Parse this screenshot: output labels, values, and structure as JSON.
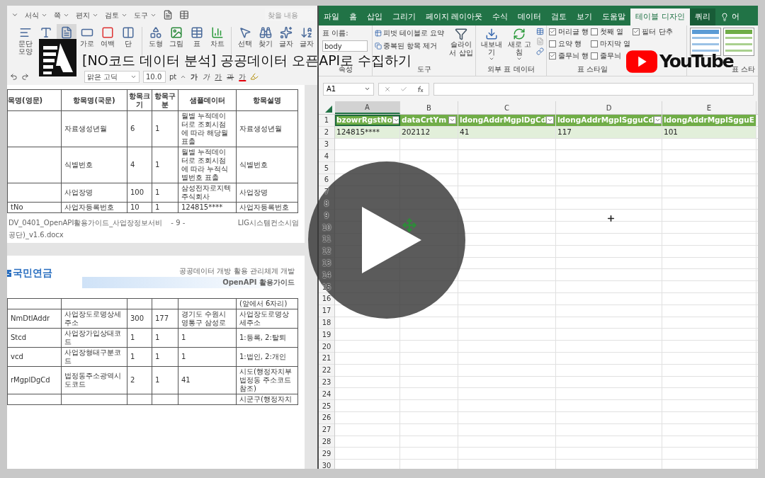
{
  "video": {
    "title": "[NO코드 데이터 분석] 공공데이터 오픈API로 수집하기",
    "platform": "YouTube"
  },
  "word": {
    "menu": [
      "서식",
      "쪽",
      "편지",
      "검토",
      "도구"
    ],
    "search": {
      "placeholder": "찾을 내용"
    },
    "ribbon": [
      {
        "label": "문단 모양",
        "selected": false
      },
      {
        "selected": false
      },
      {
        "selected": true
      },
      {
        "label": "가로",
        "selected": false
      },
      {
        "label": "여백",
        "selected": false
      },
      {
        "label": "단",
        "selected": false
      },
      {
        "label": "도형",
        "selected": false
      },
      {
        "label": "그림",
        "selected": false
      },
      {
        "label": "표",
        "selected": false
      },
      {
        "label": "차트",
        "selected": false
      },
      {
        "label": "선택",
        "selected": false
      },
      {
        "label": "찾기",
        "selected": false
      },
      {
        "label": "글자",
        "selected": false
      },
      {
        "label": "글자",
        "selected": false
      }
    ],
    "font_bar": {
      "font": "맑은 고딕",
      "size": "10.0",
      "unit": "pt",
      "format_buttons": [
        "가",
        "가",
        "가",
        "과",
        "가"
      ]
    },
    "page1": {
      "columns": [
        "목명(영문)",
        "항목명(국문)",
        "항목크기",
        "항목구분",
        "샘플데이터",
        "항목설명"
      ],
      "rows": [
        [
          null,
          "자료생성년월",
          "6",
          "1",
          "월별 누적데이터로 조회시점에 따라 해당월 표출",
          "자료생성년월"
        ],
        [
          null,
          "식별번호",
          "4",
          "1",
          "월별 누적데이터로 조회시점에 따라 누적식별번호 표출",
          "식별번호"
        ],
        [
          null,
          "사업장명",
          "100",
          "1",
          "삼성전자로지텍주식회사",
          "사업장명"
        ],
        [
          "tNo",
          "사업자등록번호",
          "10",
          "1",
          "124815****",
          "사업자등록번호"
        ]
      ],
      "footer_left": "DV_0401_OpenAPI활용가이드_사업장정보서비",
      "page_number": "- 9 -",
      "footer_right": "LIG시스템컨소시엄",
      "footer_left_2": "공단)_v1.6.docx"
    },
    "page2": {
      "logo_text": "국민연금",
      "header_1": "공공데이터 개방 활용 관리체계 개발",
      "header_2": "OpenAPI 활용가이드",
      "rows": [
        [
          null,
          null,
          null,
          null,
          null,
          "(앞에서 6자리)"
        ],
        [
          "NmDtlAddr",
          "사업장도로명상세주소",
          "300",
          "177",
          "경기도 수원시 영통구 삼성로",
          "사업장도로명상세주소"
        ],
        [
          "Stcd",
          "사업장가입상태코드",
          "1",
          "1",
          "1",
          "1:등록, 2:탈퇴"
        ],
        [
          "vcd",
          "사업장형태구분코드",
          "1",
          "1",
          "1",
          "1:법인, 2:개인"
        ],
        [
          "rMgplDgCd",
          "법정동주소광역시도코드",
          "2",
          "1",
          "41",
          "시도(행정자치부 법정동 주소코드 참조)"
        ],
        [
          null,
          null,
          null,
          null,
          null,
          "시군구(행정자치"
        ]
      ]
    }
  },
  "excel": {
    "tabs": [
      {
        "label": "파일",
        "selected": false,
        "kind": "tab"
      },
      {
        "label": "홈",
        "selected": false,
        "kind": "tab"
      },
      {
        "label": "삽입",
        "selected": false,
        "kind": "tab"
      },
      {
        "label": "그리기",
        "selected": false,
        "kind": "tab"
      },
      {
        "label": "페이지 레이아웃",
        "selected": false,
        "kind": "tab"
      },
      {
        "label": "수식",
        "selected": false,
        "kind": "tab"
      },
      {
        "label": "데이터",
        "selected": false,
        "kind": "tab"
      },
      {
        "label": "검토",
        "selected": false,
        "kind": "tab"
      },
      {
        "label": "보기",
        "selected": false,
        "kind": "tab"
      },
      {
        "label": "도움말",
        "selected": false,
        "kind": "tab"
      },
      {
        "label": "테이블 디자인",
        "selected": true,
        "kind": "tab"
      },
      {
        "label": "쿼리",
        "selected": false,
        "kind": "context"
      },
      {
        "label": "어",
        "selected": false,
        "kind": "search"
      }
    ],
    "table_name_label": "표 이름:",
    "table_name": "body",
    "group_properties": "속성",
    "tools": [
      "피벗 테이블로 요약",
      "중복된 항목 제거"
    ],
    "slicer": "슬라이서 삽입",
    "group_tools": "도구",
    "external": [
      "내보내기",
      "새로 고침"
    ],
    "group_external": "외부 표 데이터",
    "style_options": [
      {
        "label": "머리글 행",
        "checked": true
      },
      {
        "label": "요약 행",
        "checked": false
      },
      {
        "label": "줄무늬 행",
        "checked": true
      },
      {
        "label": "첫째 열",
        "checked": false
      },
      {
        "label": "마지막 열",
        "checked": false
      },
      {
        "label": "줄무늬",
        "checked": false
      },
      {
        "label": "필터 단추",
        "checked": true
      }
    ],
    "group_style_options": "표 스타일",
    "group_styles": "표 스타",
    "name_box": "A1",
    "columns": [
      {
        "label": "A",
        "selected": true
      },
      {
        "label": "B",
        "selected": false
      },
      {
        "label": "C",
        "selected": false
      },
      {
        "label": "D",
        "selected": false
      },
      {
        "label": "E",
        "selected": false
      }
    ],
    "rows": [
      {
        "kind": "header",
        "cells": [
          {
            "text": "bzowrRgstNo",
            "selected": true,
            "filter_button": true
          },
          {
            "text": "dataCrtYm",
            "selected": false,
            "filter_button": true
          },
          {
            "text": "ldongAddrMgplDgCd",
            "selected": false,
            "filter_button": true
          },
          {
            "text": "ldongAddrMgplSgguCd",
            "selected": false,
            "filter_button": true
          },
          {
            "text": "ldongAddrMgplSgguE",
            "selected": false,
            "filter_button": false
          }
        ]
      },
      {
        "kind": "data",
        "cells": [
          {
            "text": "124815****",
            "selected": false
          },
          {
            "text": "202112",
            "selected": false
          },
          {
            "text": "41",
            "selected": false
          },
          {
            "text": "117",
            "selected": false
          },
          {
            "text": "101",
            "selected": false
          }
        ]
      }
    ],
    "row_numbers": [
      "1",
      "2",
      "3",
      "4",
      "5",
      "6",
      "7",
      "8",
      "9",
      "10",
      "11",
      "12",
      "13",
      "14",
      "15",
      "16",
      "17",
      "18",
      "19",
      "20",
      "21",
      "22",
      "23",
      "24",
      "25",
      "26",
      "27",
      "28",
      "29",
      "30"
    ]
  }
}
